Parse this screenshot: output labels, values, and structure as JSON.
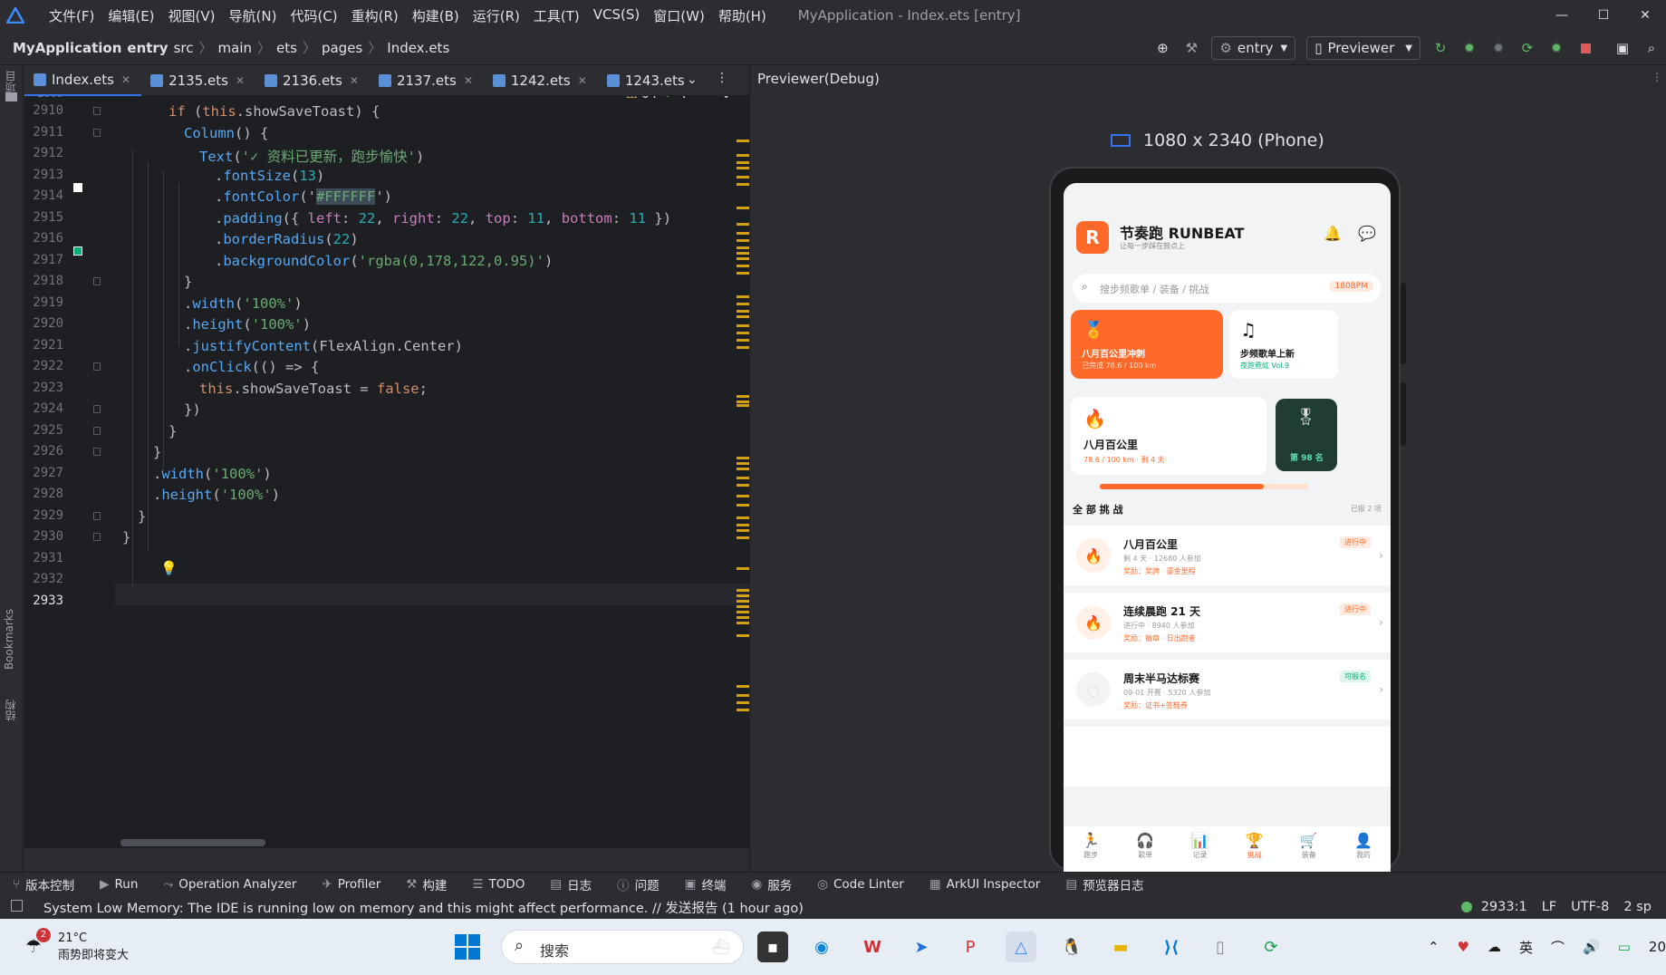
{
  "window": {
    "title": "MyApplication - Index.ets [entry]",
    "menu": [
      "文件(F)",
      "编辑(E)",
      "视图(V)",
      "导航(N)",
      "代码(C)",
      "重构(R)",
      "构建(B)",
      "运行(R)",
      "工具(T)",
      "VCS(S)",
      "窗口(W)",
      "帮助(H)"
    ],
    "controls": [
      "—",
      "☐",
      "✕"
    ]
  },
  "breadcrumb": [
    "MyApplication",
    "entry",
    "src",
    "main",
    "ets",
    "pages",
    "Index.ets"
  ],
  "toolbar": {
    "module": "entry",
    "device": "Previewer"
  },
  "left_strip": {
    "project": "项目",
    "bookmarks": "Bookmarks",
    "structure": "结构"
  },
  "tabs": [
    {
      "label": "Index.ets",
      "active": true
    },
    {
      "label": "2135.ets"
    },
    {
      "label": "2136.ets"
    },
    {
      "label": "2137.ets"
    },
    {
      "label": "1242.ets"
    },
    {
      "label": "1243.ets"
    }
  ],
  "inspections": {
    "warnings": "64",
    "weak": "4"
  },
  "editor": {
    "first_line_partial": "2909",
    "current_line": "2933",
    "lines": [
      {
        "n": "2910",
        "indent": 3,
        "code": "if (this.showSaveToast) {"
      },
      {
        "n": "2911",
        "indent": 4,
        "code": "Column() {"
      },
      {
        "n": "2912",
        "indent": 5,
        "code": "Text('✓ 资料已更新，跑步愉快')"
      },
      {
        "n": "2913",
        "indent": 6,
        "code": ".fontSize(13)"
      },
      {
        "n": "2914",
        "indent": 6,
        "code": ".fontColor('#FFFFFF')"
      },
      {
        "n": "2915",
        "indent": 6,
        "code": ".padding({ left: 22, right: 22, top: 11, bottom: 11 })"
      },
      {
        "n": "2916",
        "indent": 6,
        "code": ".borderRadius(22)"
      },
      {
        "n": "2917",
        "indent": 6,
        "code": ".backgroundColor('rgba(0,178,122,0.95)')"
      },
      {
        "n": "2918",
        "indent": 4,
        "code": "}"
      },
      {
        "n": "2919",
        "indent": 4,
        "code": ".width('100%')"
      },
      {
        "n": "2920",
        "indent": 4,
        "code": ".height('100%')"
      },
      {
        "n": "2921",
        "indent": 4,
        "code": ".justifyContent(FlexAlign.Center)"
      },
      {
        "n": "2922",
        "indent": 4,
        "code": ".onClick(() => {"
      },
      {
        "n": "2923",
        "indent": 5,
        "code": "this.showSaveToast = false;"
      },
      {
        "n": "2924",
        "indent": 4,
        "code": "})"
      },
      {
        "n": "2925",
        "indent": 3,
        "code": "}"
      },
      {
        "n": "2926",
        "indent": 2,
        "code": "}"
      },
      {
        "n": "2927",
        "indent": 2,
        "code": ".width('100%')"
      },
      {
        "n": "2928",
        "indent": 2,
        "code": ".height('100%')"
      },
      {
        "n": "2929",
        "indent": 1,
        "code": "}"
      },
      {
        "n": "2930",
        "indent": 0,
        "code": "}"
      },
      {
        "n": "2931",
        "indent": 0,
        "code": ""
      },
      {
        "n": "2932",
        "indent": 0,
        "code": ""
      },
      {
        "n": "2933",
        "indent": 0,
        "code": ""
      }
    ],
    "gutter_colors": {
      "white": "#FFFFFF",
      "green": "rgba(0,178,122,0.95)"
    }
  },
  "previewer": {
    "title": "Previewer(Debug)",
    "device": "1080 x 2340 (Phone)",
    "app": {
      "logo_letter": "R",
      "name": "节奏跑 RUNBEAT",
      "slogan": "让每一步踩在鼓点上",
      "search_placeholder": "搜步频歌单 / 装备 / 挑战",
      "bpm_badge": "180BPM",
      "banner1": {
        "title": "八月百公里冲刺",
        "sub": "已完成 78.6 / 100 km"
      },
      "banner2": {
        "title": "步频歌单上新",
        "sub": "夜跑霓虹 Vol.9"
      },
      "challenge_card": {
        "title": "八月百公里",
        "sub": "78.6 / 100 km · 剩 4 天"
      },
      "rank_card": {
        "label": "第 98 名"
      },
      "progress": 0.786,
      "section_title": "全 部 挑 战",
      "section_count": "已报 2 项",
      "rows": [
        {
          "icon": "🔥",
          "title": "八月百公里",
          "sub": "剩 4 天 · 12680 人参加",
          "reward": "奖励：奖牌 · 鎏金里程",
          "badge": "进行中",
          "badge_kind": "active"
        },
        {
          "icon": "🔥",
          "title": "连续晨跑 21 天",
          "sub": "进行中 · 8940 人参加",
          "reward": "奖励：徽章 · 日出跑者",
          "badge": "进行中",
          "badge_kind": "active"
        },
        {
          "icon": "○",
          "title": "周末半马达标赛",
          "sub": "09-01 开赛 · 5320 人参加",
          "reward": "奖励：证书+签鞋券",
          "badge": "可报名",
          "badge_kind": "open"
        }
      ],
      "tabbar": [
        {
          "icon": "🏃",
          "label": "跑步"
        },
        {
          "icon": "🎧",
          "label": "歌单"
        },
        {
          "icon": "📊",
          "label": "记录"
        },
        {
          "icon": "🏆",
          "label": "挑战",
          "active": true
        },
        {
          "icon": "🛒",
          "label": "装备"
        },
        {
          "icon": "👤",
          "label": "我的"
        }
      ]
    }
  },
  "bottom_tools": [
    "版本控制",
    "Run",
    "Operation Analyzer",
    "Profiler",
    "构建",
    "TODO",
    "日志",
    "问题",
    "终端",
    "服务",
    "Code Linter",
    "ArkUI Inspector",
    "预览器日志"
  ],
  "status": {
    "message": "System Low Memory: The IDE is running low on memory and this might affect performance. // 发送报告 (1 hour ago)",
    "position": "2933:1",
    "line_sep": "LF",
    "encoding": "UTF-8",
    "indent": "2 sp"
  },
  "taskbar": {
    "weather_badge": "2",
    "temp": "21°C",
    "weather": "雨势即将变大",
    "search_placeholder": "搜索",
    "ime": "英",
    "clock_partial": "20"
  }
}
